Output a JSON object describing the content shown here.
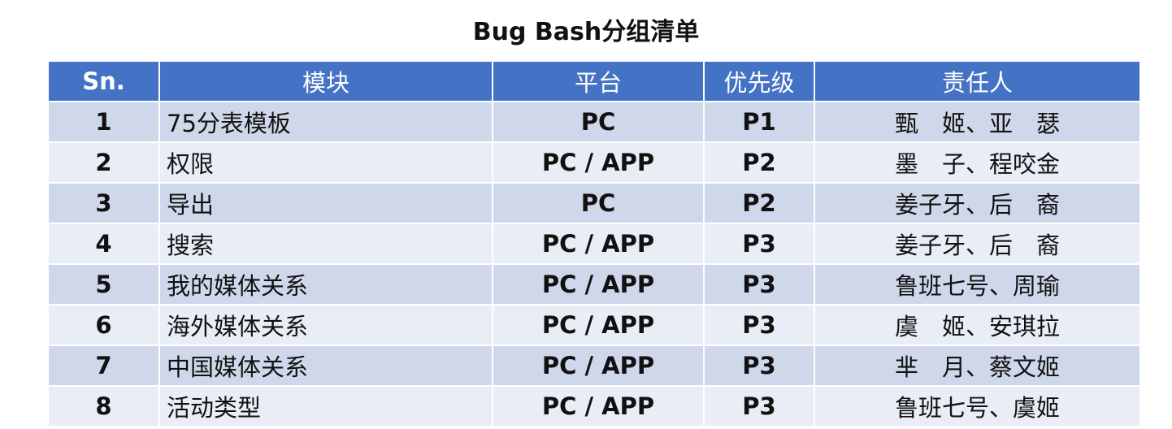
{
  "title": "Bug Bash分组清单",
  "colors": {
    "header_bg": "#4472c4",
    "row_odd_bg": "#cfd7ea",
    "row_even_bg": "#e9edf5"
  },
  "table": {
    "headers": [
      "Sn.",
      "模块",
      "平台",
      "优先级",
      "责任人"
    ],
    "rows": [
      {
        "sn": "1",
        "module": "75分表模板",
        "platform": "PC",
        "priority": "P1",
        "owner": "甄　姬、亚　瑟"
      },
      {
        "sn": "2",
        "module": "权限",
        "platform": "PC / APP",
        "priority": "P2",
        "owner": "墨　子、程咬金"
      },
      {
        "sn": "3",
        "module": "导出",
        "platform": "PC",
        "priority": "P2",
        "owner": "姜子牙、后　裔"
      },
      {
        "sn": "4",
        "module": "搜索",
        "platform": "PC / APP",
        "priority": "P3",
        "owner": "姜子牙、后　裔"
      },
      {
        "sn": "5",
        "module": "我的媒体关系",
        "platform": "PC / APP",
        "priority": "P3",
        "owner": "鲁班七号、周瑜"
      },
      {
        "sn": "6",
        "module": "海外媒体关系",
        "platform": "PC / APP",
        "priority": "P3",
        "owner": "虞　姬、安琪拉"
      },
      {
        "sn": "7",
        "module": "中国媒体关系",
        "platform": "PC / APP",
        "priority": "P3",
        "owner": "芈　月、蔡文姬"
      },
      {
        "sn": "8",
        "module": "活动类型",
        "platform": "PC / APP",
        "priority": "P3",
        "owner": "鲁班七号、虞姬"
      }
    ]
  }
}
